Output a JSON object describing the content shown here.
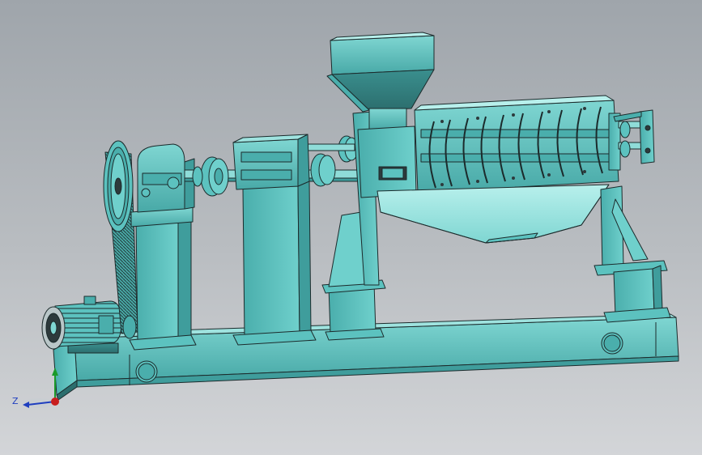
{
  "viewport": {
    "background_top": "#9fa5ab",
    "background_bottom": "#d3d5d8"
  },
  "model": {
    "part_color": "#5fc7c4",
    "part_color_light": "#8fdcd8",
    "part_color_dark": "#3f9d9c",
    "edge_color": "#1c2b2c"
  },
  "triad": {
    "z_label": "Z",
    "z_color": "#1f3fbf",
    "y_color": "#1b9a2a",
    "x_color": "#c81e1e"
  }
}
